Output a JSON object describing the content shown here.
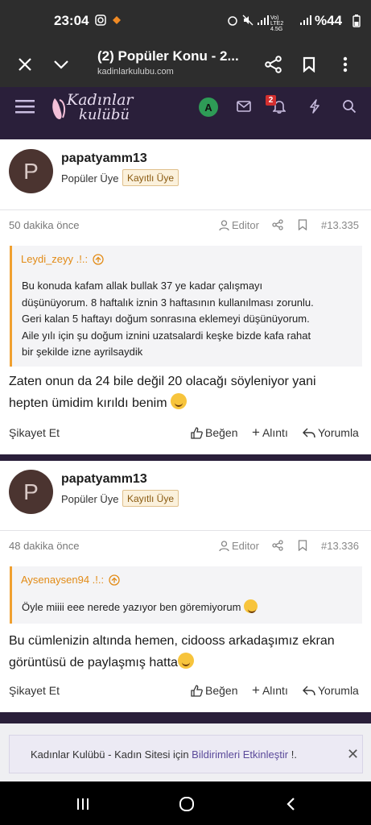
{
  "status": {
    "time": "23:04",
    "battery": "%44",
    "network": "Vo) LTE2 4.5G"
  },
  "browser": {
    "tab_title": "(2) Popüler Konu - 2...",
    "url": "kadinlarkulubu.com"
  },
  "site": {
    "logo_line1": "Kadınlar",
    "logo_line2": "kulübü",
    "user_initial": "A",
    "notif_count": "2"
  },
  "posts": [
    {
      "username": "papatyamm13",
      "role": "Popüler Üye",
      "badge": "Kayıtlı Üye",
      "avatar_letter": "P",
      "time_ago": "50 dakika önce",
      "editor_label": "Editor",
      "post_number": "#13.335",
      "quote_author": "Leydi_zeyy .!.:",
      "quote_lines": [
        "Bu konuda kafam allak bullak 37 ye kadar çalışmayı",
        "düşünüyorum. 8 haftalık iznin 3 haftasının kullanılması zorunlu.",
        "Geri kalan 5 haftayı doğum sonrasına eklemeyi düşünüyorum.",
        "Aile yılı için şu doğum iznini uzatsalardi keşke bizde kafa rahat",
        "bir şekilde izne ayrilsaydik"
      ],
      "body_lines": [
        "Zaten onun da 24 bile değil 20 olacağı söyleniyor yani",
        "hepten ümidim kırıldı benim"
      ],
      "report": "Şikayet Et",
      "like": "Beğen",
      "quote_btn": "Alıntı",
      "comment": "Yorumla"
    },
    {
      "username": "papatyamm13",
      "role": "Popüler Üye",
      "badge": "Kayıtlı Üye",
      "avatar_letter": "P",
      "time_ago": "48 dakika önce",
      "editor_label": "Editor",
      "post_number": "#13.336",
      "quote_author": "Aysenaysen94 .!.:",
      "quote_lines": [
        "Öyle miiii eee nerede yazıyor ben göremiyorum"
      ],
      "body_lines": [
        "Bu cümlenizin altında hemen, cidooss arkadaşımız ekran",
        "görüntüsü de paylaşmış hatta"
      ],
      "report": "Şikayet Et",
      "like": "Beğen",
      "quote_btn": "Alıntı",
      "comment": "Yorumla"
    }
  ],
  "notification": {
    "text_before": "Kadınlar Kulübü - Kadın Sitesi için ",
    "link": "Bildirimleri Etkinleştir",
    "text_after": " !."
  },
  "colors": {
    "site_bar": "#2a1f3a",
    "accent_orange": "#e28b16",
    "quote_border": "#f0a030"
  }
}
